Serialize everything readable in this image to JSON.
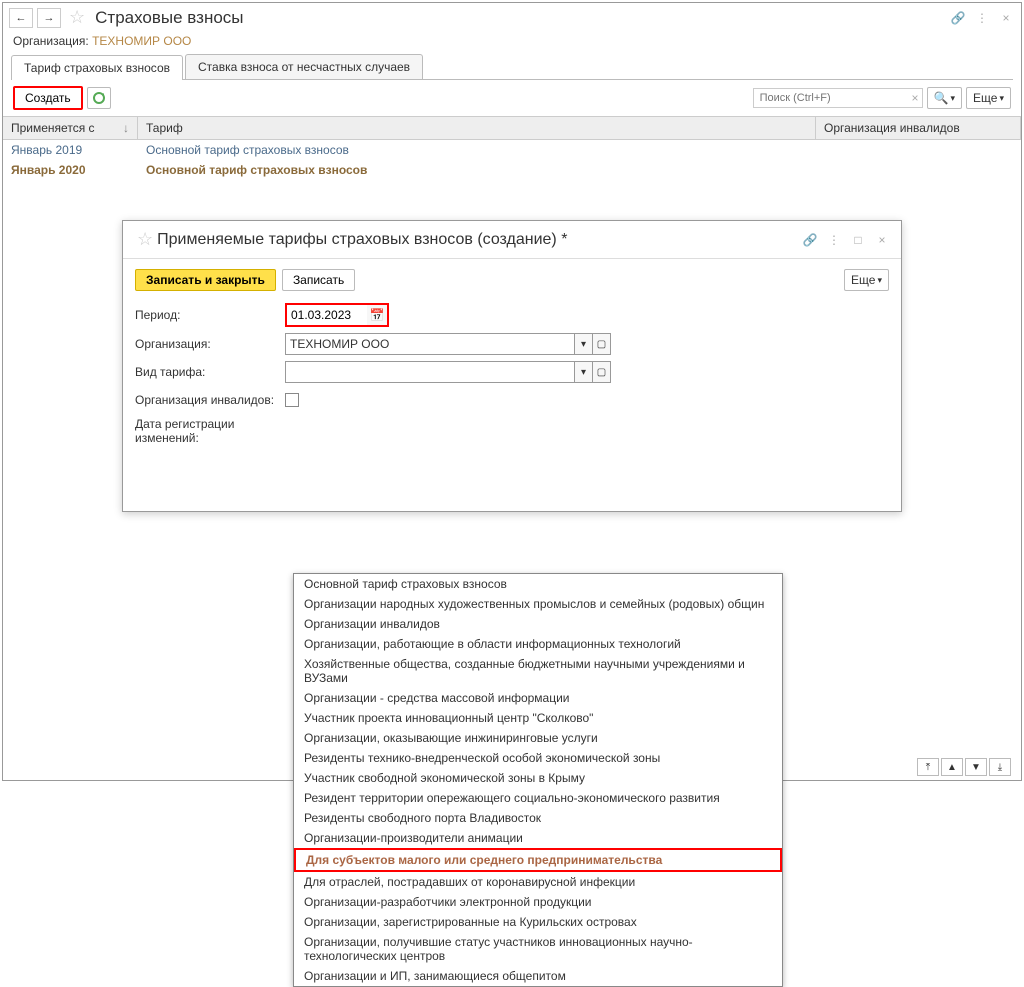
{
  "header": {
    "title": "Страховые взносы",
    "org_label": "Организация:",
    "org_value": "ТЕХНОМИР ООО"
  },
  "tabs": {
    "t1": "Тариф страховых взносов",
    "t2": "Ставка взноса от несчастных случаев"
  },
  "cmd": {
    "create": "Создать",
    "search_ph": "Поиск (Ctrl+F)",
    "more": "Еще"
  },
  "grid": {
    "head": {
      "c1": "Применяется с",
      "c2": "Тариф",
      "c3": "Организация инвалидов"
    },
    "rows": [
      {
        "date": "Январь 2019",
        "tarif": "Основной тариф страховых взносов",
        "style": "link1"
      },
      {
        "date": "Январь 2020",
        "tarif": "Основной тариф страховых взносов",
        "style": "bold"
      }
    ]
  },
  "dialog": {
    "title": "Применяемые тарифы страховых взносов (создание) *",
    "save_close": "Записать и закрыть",
    "save": "Записать",
    "more": "Еще",
    "fields": {
      "period_label": "Период:",
      "period_value": "01.03.2023",
      "org_label": "Организация:",
      "org_value": "ТЕХНОМИР ООО",
      "kind_label": "Вид тарифа:",
      "inv_label": "Организация инвалидов:",
      "reg_label": "Дата регистрации изменений:"
    }
  },
  "dropdown": [
    "Основной тариф страховых взносов",
    "Организации народных художественных промыслов и семейных (родовых) общин",
    "Организации инвалидов",
    "Организации, работающие в области информационных технологий",
    "Хозяйственные общества, созданные бюджетными научными учреждениями и ВУЗами",
    "Организации - средства массовой информации",
    "Участник проекта инновационный центр \"Сколково\"",
    "Организации, оказывающие инжиниринговые услуги",
    "Резиденты технико-внедренческой особой экономической зоны",
    "Участник свободной экономической зоны в Крыму",
    "Резидент территории опережающего социально-экономического развития",
    "Резиденты свободного порта Владивосток",
    "Организации-производители анимации",
    "Для субъектов малого или среднего предпринимательства",
    "Для отраслей, пострадавших от коронавирусной инфекции",
    "Организации-разработчики электронной продукции",
    "Организации, зарегистрированные на Курильских островах",
    "Организации, получившие статус участников инновационных научно-технологических центров",
    "Организации и ИП, занимающиеся общепитом"
  ],
  "highlighted_dd_index": 13
}
